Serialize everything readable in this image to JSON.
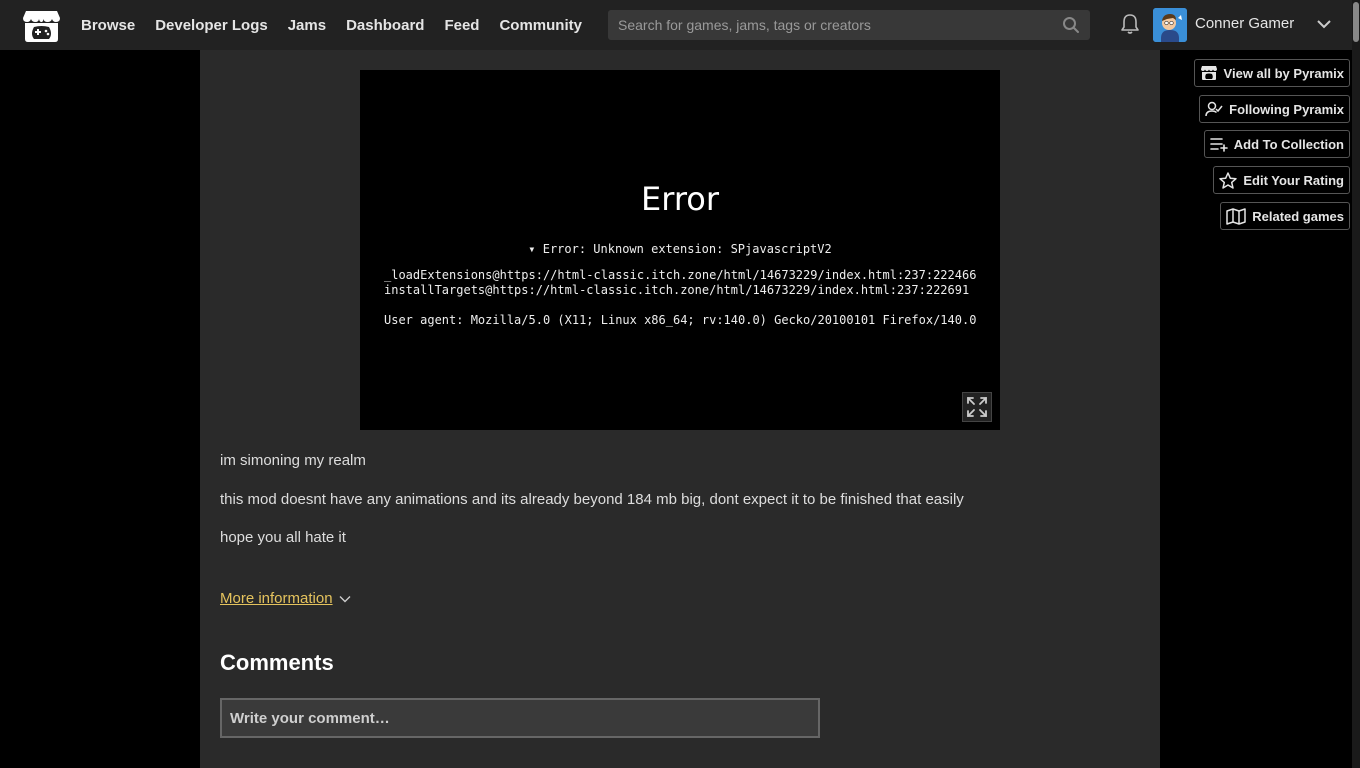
{
  "header": {
    "nav": [
      "Browse",
      "Developer Logs",
      "Jams",
      "Dashboard",
      "Feed",
      "Community"
    ],
    "search_placeholder": "Search for games, jams, tags or creators",
    "username": "Conner Gamer"
  },
  "game": {
    "error_title": "Error",
    "error_summary": "▾ Error: Unknown extension: SPjavascriptV2",
    "stack_1": "_loadExtensions@https://html-classic.itch.zone/html/14673229/index.html:237:222466",
    "stack_2": "installTargets@https://html-classic.itch.zone/html/14673229/index.html:237:222691",
    "user_agent": "User agent: Mozilla/5.0 (X11; Linux x86_64; rv:140.0) Gecko/20100101 Firefox/140.0"
  },
  "description": {
    "line_1": "im simoning my realm",
    "line_2": "this mod doesnt have any animations and its already beyond 184 mb big, dont expect it to be finished that easily",
    "line_3": "hope you all hate it"
  },
  "more_information": "More information",
  "comments": {
    "title": "Comments",
    "placeholder": "Write your comment…"
  },
  "sidebar": {
    "view_all": "View all by Pyramix",
    "following": "Following Pyramix",
    "add_collection": "Add To Collection",
    "edit_rating": "Edit Your Rating",
    "related": "Related games"
  },
  "colors": {
    "accent_link": "#e5c35d",
    "header_bg": "#222222",
    "content_bg": "#2a2a2a"
  }
}
